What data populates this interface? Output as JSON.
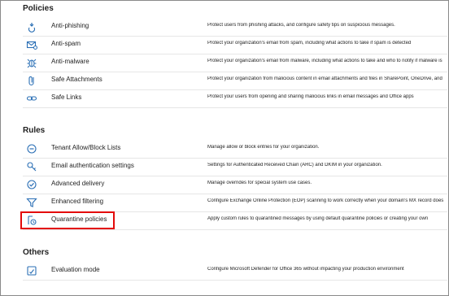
{
  "sections": {
    "policies": {
      "title": "Policies",
      "items": [
        {
          "name": "Anti-phishing",
          "icon": "anti-phishing-icon",
          "description": "Protect users from phishing attacks, and configure safety tips on suspicious messages."
        },
        {
          "name": "Anti-spam",
          "icon": "anti-spam-icon",
          "description": "Protect your organization's email from spam, including what actions to take if spam is detected"
        },
        {
          "name": "Anti-malware",
          "icon": "anti-malware-icon",
          "description": "Protect your organization's email from malware, including what actions to take and who to notify if malware is"
        },
        {
          "name": "Safe Attachments",
          "icon": "attachment-icon",
          "description": "Protect your organization from malicious content in email attachments and files in SharePoint, OneDrive, and"
        },
        {
          "name": "Safe Links",
          "icon": "link-icon",
          "description": "Protect your users from opening and sharing malicious links in email messages and Office apps"
        }
      ]
    },
    "rules": {
      "title": "Rules",
      "items": [
        {
          "name": "Tenant Allow/Block Lists",
          "icon": "block-icon",
          "description": "Manage allow or block entries for your organization."
        },
        {
          "name": "Email authentication settings",
          "icon": "key-icon",
          "description": "Settings for Authenticated Received Chain (ARC) and DKIM in your organization."
        },
        {
          "name": "Advanced delivery",
          "icon": "checkmark-icon",
          "description": "Manage overrides for special system use cases."
        },
        {
          "name": "Enhanced filtering",
          "icon": "filter-icon",
          "description": "Configure Exchange Online Protection (EOP) scanning to work correctly when your domain's MX record does"
        },
        {
          "name": "Quarantine policies",
          "icon": "quarantine-policy-icon",
          "description": "Apply custom rules to quarantined messages by using default quarantine policies or creating your own"
        }
      ]
    },
    "others": {
      "title": "Others",
      "items": [
        {
          "name": "Evaluation mode",
          "icon": "evaluation-icon",
          "description": "Configure Microsoft Defender for Office 365 without impacting your production environment"
        }
      ]
    }
  },
  "colors": {
    "highlight": "#e30a0a",
    "icon": "#2a6fb5",
    "divider": "#e6e6e6"
  }
}
